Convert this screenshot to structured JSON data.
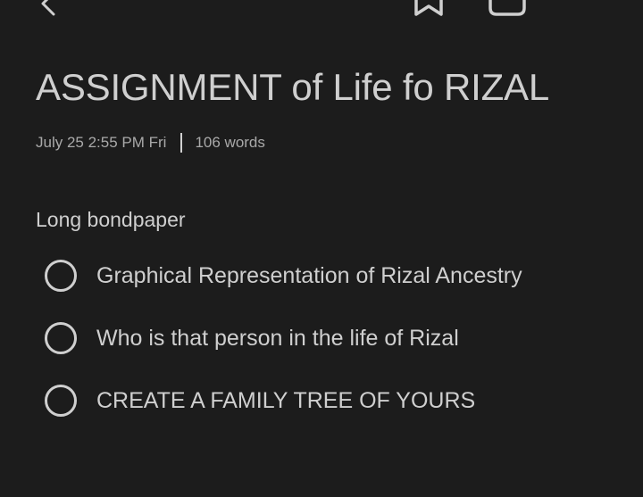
{
  "note": {
    "title": "ASSIGNMENT of Life fo RIZAL",
    "date": "July 25 2:55 PM Fri",
    "word_count": "106 words",
    "paragraph": "Long bondpaper",
    "checklist": [
      {
        "label": "Graphical Representation of Rizal Ancestry",
        "checked": false
      },
      {
        "label": "Who is that person in the life of Rizal",
        "checked": false
      },
      {
        "label": "CREATE A FAMILY TREE OF YOURS",
        "checked": false
      }
    ]
  },
  "toolbar": {
    "icons": [
      "back-arrow-icon",
      "bookmark-icon",
      "page-icon",
      "more-icon"
    ]
  },
  "colors": {
    "background": "#1c1c1c",
    "text": "#cfcfcf",
    "meta_text": "#a9a9a9"
  }
}
